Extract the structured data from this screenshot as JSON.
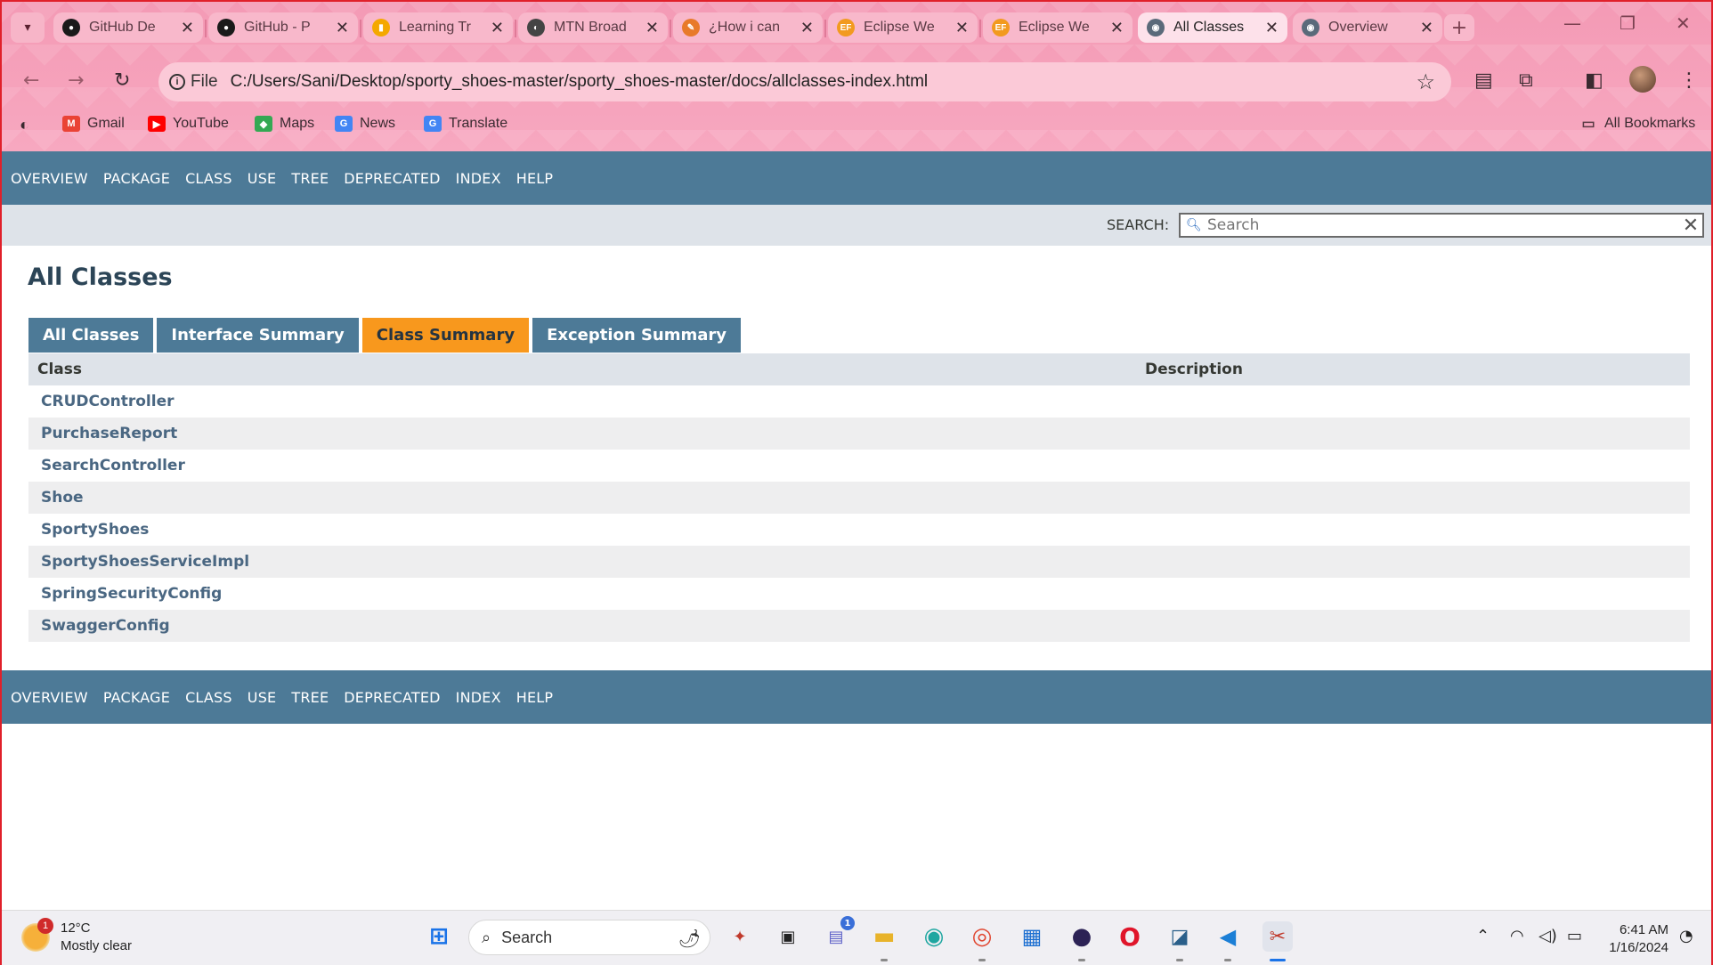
{
  "browser": {
    "tabs": [
      {
        "label": "GitHub De",
        "favicon": "github-icon",
        "active": false
      },
      {
        "label": "GitHub - P",
        "favicon": "github-icon",
        "active": false
      },
      {
        "label": "Learning Tr",
        "favicon": "chart-bars-icon",
        "active": false
      },
      {
        "label": "MTN Broad",
        "favicon": "mtn-icon",
        "active": false
      },
      {
        "label": "¿How i can",
        "favicon": "pen-icon",
        "active": false
      },
      {
        "label": "Eclipse We",
        "favicon": "ef-icon",
        "favicon_text": "EF",
        "active": false
      },
      {
        "label": "Eclipse We",
        "favicon": "ef-icon",
        "favicon_text": "EF",
        "active": false
      },
      {
        "label": "All Classes",
        "favicon": "globe-icon",
        "active": true
      },
      {
        "label": "Overview",
        "favicon": "globe-icon",
        "active": false
      }
    ],
    "address": {
      "chip": "File",
      "url": "C:/Users/Sani/Desktop/sporty_shoes-master/sporty_shoes-master/docs/allclasses-index.html"
    },
    "bookmarks": [
      {
        "label": "Gmail",
        "icon": "gmail-icon"
      },
      {
        "label": "YouTube",
        "icon": "youtube-icon"
      },
      {
        "label": "Maps",
        "icon": "maps-icon"
      },
      {
        "label": "News",
        "icon": "news-icon"
      },
      {
        "label": "Translate",
        "icon": "translate-icon"
      }
    ],
    "all_bookmarks": "All Bookmarks",
    "theme_color": "#f49ab5"
  },
  "javadoc": {
    "nav": [
      "OVERVIEW",
      "PACKAGE",
      "CLASS",
      "USE",
      "TREE",
      "DEPRECATED",
      "INDEX",
      "HELP"
    ],
    "search_label": "SEARCH:",
    "search_placeholder": "Search",
    "title": "All Classes",
    "tabs": [
      {
        "label": "All Classes",
        "active": false
      },
      {
        "label": "Interface Summary",
        "active": false
      },
      {
        "label": "Class Summary",
        "active": true
      },
      {
        "label": "Exception Summary",
        "active": false
      }
    ],
    "table": {
      "headers": [
        "Class",
        "Description"
      ],
      "rows": [
        {
          "class": "CRUDController",
          "description": ""
        },
        {
          "class": "PurchaseReport",
          "description": ""
        },
        {
          "class": "SearchController",
          "description": ""
        },
        {
          "class": "Shoe",
          "description": ""
        },
        {
          "class": "SportyShoes",
          "description": ""
        },
        {
          "class": "SportyShoesServiceImpl",
          "description": ""
        },
        {
          "class": "SpringSecurityConfig",
          "description": ""
        },
        {
          "class": "SwaggerConfig",
          "description": ""
        }
      ]
    },
    "colors": {
      "nav": "#4d7a97",
      "active_tab": "#f8981d",
      "link": "#4a6782"
    }
  },
  "taskbar": {
    "weather": {
      "temp": "12°C",
      "condition": "Mostly clear",
      "badge": "1"
    },
    "search_placeholder": "Search",
    "apps": [
      "windows-start-icon",
      "copilot-icon",
      "task-view-icon",
      "teams-icon",
      "file-explorer-icon",
      "edge-icon",
      "chrome-icon",
      "store-icon",
      "eclipse-icon",
      "opera-icon",
      "mysql-workbench-icon",
      "vscode-icon",
      "snipping-tool-icon"
    ],
    "teams_badge": "1",
    "time": "6:41 AM",
    "date": "1/16/2024"
  }
}
